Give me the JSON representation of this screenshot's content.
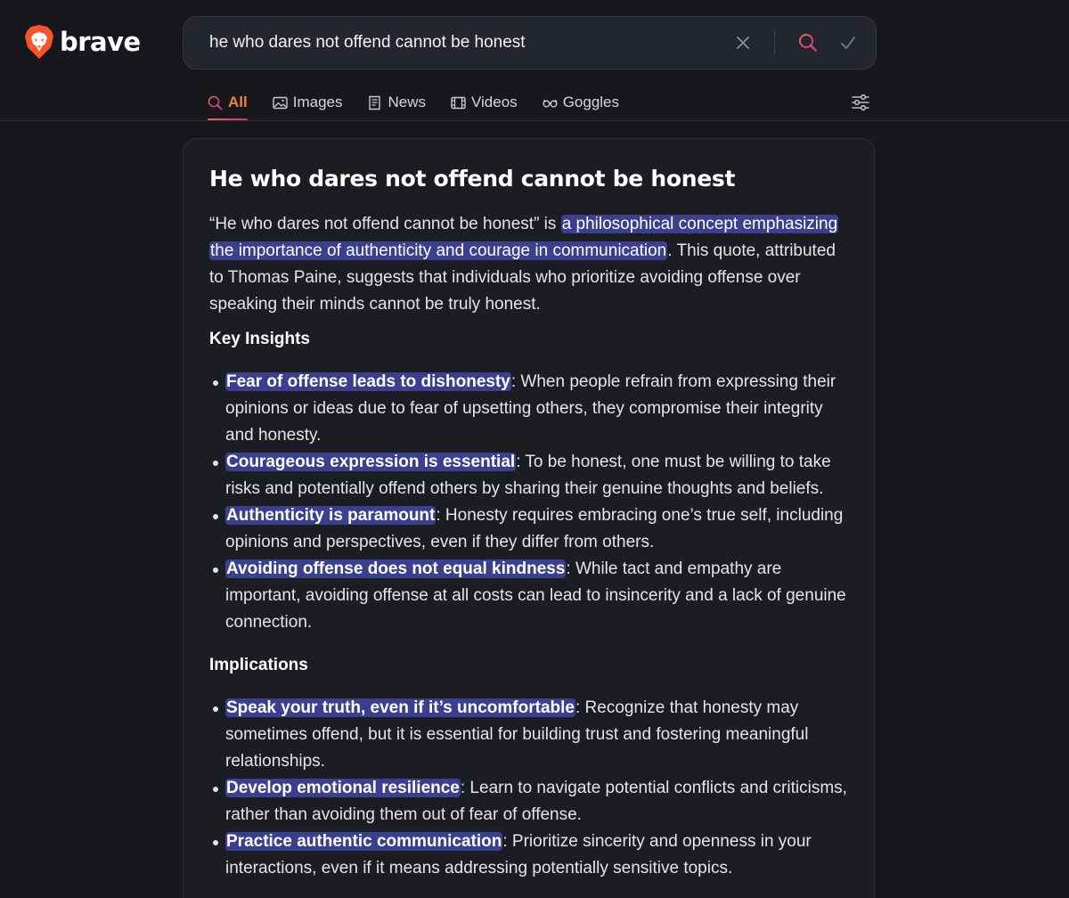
{
  "brand": {
    "name": "brave"
  },
  "search": {
    "query": "he who dares not offend cannot be honest"
  },
  "tabs": [
    {
      "label": "All",
      "icon": "search-icon",
      "active": true
    },
    {
      "label": "Images",
      "icon": "image-icon",
      "active": false
    },
    {
      "label": "News",
      "icon": "news-icon",
      "active": false
    },
    {
      "label": "Videos",
      "icon": "video-icon",
      "active": false
    },
    {
      "label": "Goggles",
      "icon": "goggles-icon",
      "active": false
    }
  ],
  "answer": {
    "title": "He who dares not offend cannot be honest",
    "intro": {
      "pre": "“He who dares not offend cannot be honest” is ",
      "highlight": "a philosophical concept emphasizing the importance of authenticity and courage in communication",
      "post": ". This quote, attributed to Thomas Paine, suggests that individuals who prioritize avoiding offense over speaking their minds cannot be truly honest."
    },
    "sections": [
      {
        "heading": "Key Insights",
        "items": [
          {
            "term": "Fear of offense leads to dishonesty",
            "text": ": When people refrain from expressing their opinions or ideas due to fear of upsetting others, they compromise their integrity and honesty."
          },
          {
            "term": "Courageous expression is essential",
            "text": ": To be honest, one must be willing to take risks and potentially offend others by sharing their genuine thoughts and beliefs."
          },
          {
            "term": "Authenticity is paramount",
            "text": ": Honesty requires embracing one’s true self, including opinions and perspectives, even if they differ from others."
          },
          {
            "term": "Avoiding offense does not equal kindness",
            "text": ": While tact and empathy are important, avoiding offense at all costs can lead to insincerity and a lack of genuine connection."
          }
        ]
      },
      {
        "heading": "Implications",
        "items": [
          {
            "term": "Speak your truth, even if it’s uncomfortable",
            "text": ": Recognize that honesty may sometimes offend, but it is essential for building trust and fostering meaningful relationships."
          },
          {
            "term": "Develop emotional resilience",
            "text": ": Learn to navigate potential conflicts and criticisms, rather than avoiding them out of fear of offense."
          },
          {
            "term": "Practice authentic communication",
            "text": ": Prioritize sincerity and openness in your interactions, even if it means addressing potentially sensitive topics."
          }
        ]
      }
    ]
  },
  "colors": {
    "background": "#17181c",
    "card": "#1c1d22",
    "highlight": "#3b3f8f",
    "accent": "#f0813c",
    "brand_orange": "#fb542b"
  }
}
